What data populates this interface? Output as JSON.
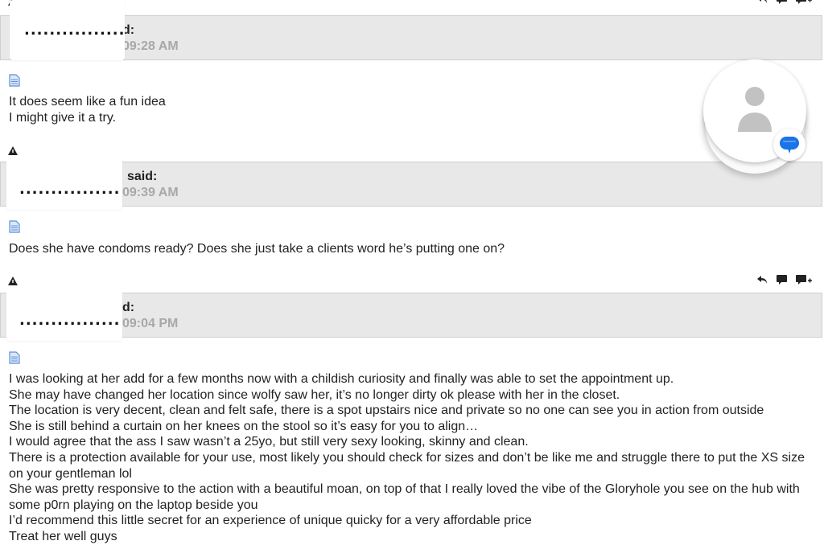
{
  "posts": [
    {
      "author_suffix": "d:",
      "time": "09:28 AM",
      "mask_dots": "................",
      "lines": [
        "It does seem like a fun idea",
        "I might give it a try."
      ]
    },
    {
      "author_suffix": "said:",
      "time": "09:39 AM",
      "mask_dots": "................",
      "lines": [
        "Does she have condoms ready? Does she just take a clients word he’s putting one on?"
      ]
    },
    {
      "author_suffix": "d:",
      "time": "09:04 PM",
      "mask_dots": "................",
      "lines": [
        "I was looking at her add for a few months now with a childish curiosity and finally was able to set the appointment up.",
        "She may have changed her location since wolfy saw her, it’s no longer dirty ok please with her in the closet.",
        "The location is very decent, clean and felt safe, there is a spot upstairs nice and private so no one can see you in action from outside",
        "She is still behind a curtain on her knees on the stool so it’s easy for you to align…",
        "I would agree that the ass I saw wasn’t a 25yo, but still very sexy looking, skinny and clean.",
        "There is a protection available for your use, most likely you should check for sizes and don’t be like me and struggle there to put the XS size on your gentleman lol",
        "She was pretty responsive to the action with a beautiful moan, on top of that I really loved the vibe of the Gloryhole you see on the hub with some p0rn playing on the laptop beside you",
        "I’d recommend this little secret for an experience of unique quicky for a very affordable price",
        "Treat her well guys"
      ]
    }
  ],
  "icons": {
    "reply": "reply-icon",
    "quote": "quote-icon",
    "multiquote": "multiquote-icon",
    "report": "report-icon",
    "post": "document-icon",
    "avatar": "user-avatar-icon",
    "chat": "chat-bubble-icon"
  },
  "colors": {
    "header_bg": "#e8e8e8",
    "time_text": "#a8a8a8",
    "chat_blue": "#1a73e8",
    "doc_blue": "#5b8fd6"
  }
}
